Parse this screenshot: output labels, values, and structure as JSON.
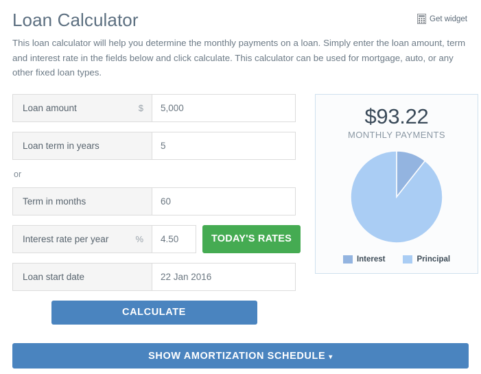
{
  "header": {
    "title": "Loan Calculator",
    "get_widget_label": "Get widget",
    "get_widget_icon": "calculator-icon",
    "description": "This loan calculator will help you determine the monthly payments on a loan. Simply enter the loan amount, term and interest rate in the fields below and click calculate. This calculator can be used for mortgage, auto, or any other fixed loan types."
  },
  "form": {
    "or_text": "or",
    "fields": [
      {
        "label": "Loan amount",
        "unit": "$",
        "value": "5,000"
      },
      {
        "label": "Loan term in years",
        "unit": "",
        "value": "5"
      },
      {
        "label": "Term in months",
        "unit": "",
        "value": "60"
      },
      {
        "label": "Interest rate per year",
        "unit": "%",
        "value": "4.50"
      },
      {
        "label": "Loan start date",
        "unit": "",
        "value": "22 Jan 2016"
      }
    ],
    "rates_button": "TODAY'S RATES",
    "calculate_button": "CALCULATE"
  },
  "result": {
    "amount": "$93.22",
    "caption": "MONTHLY PAYMENTS"
  },
  "footer": {
    "amortization_button": "SHOW AMORTIZATION SCHEDULE",
    "caret": "▾"
  },
  "colors": {
    "accent_blue": "#4a84bf",
    "green": "#45ab52",
    "interest": "#93b4e0",
    "principal": "#aacdf4",
    "panel_border": "#cfe0ee",
    "title": "#5c6f80"
  },
  "chart_data": {
    "type": "pie",
    "title": "",
    "labels": [
      "Interest",
      "Principal"
    ],
    "values": [
      593.2,
      5000
    ],
    "percents": [
      11.9,
      88.1
    ],
    "colors": [
      "#93b4e0",
      "#aacdf4"
    ],
    "legend_position": "bottom",
    "start_angle_deg": 0,
    "slice_angles_deg": [
      43,
      317
    ]
  }
}
